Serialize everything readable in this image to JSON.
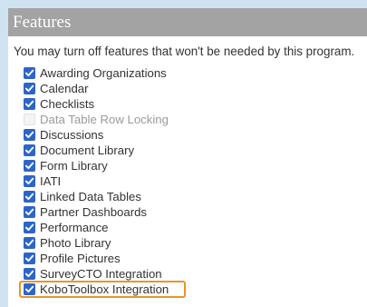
{
  "panel": {
    "title": "Features",
    "intro": "You may turn off features that won't be needed by this program."
  },
  "colors": {
    "checkbox_checked": "#2d64c8",
    "header_background": "#a3a3a3",
    "highlight": "#e6962e",
    "page_background": "#cfe4f0"
  },
  "features": [
    {
      "label": "Awarding Organizations",
      "checked": true
    },
    {
      "label": "Calendar",
      "checked": true
    },
    {
      "label": "Checklists",
      "checked": true
    },
    {
      "label": "Data Table Row Locking",
      "checked": false,
      "disabled": true
    },
    {
      "label": "Discussions",
      "checked": true
    },
    {
      "label": "Document Library",
      "checked": true
    },
    {
      "label": "Form Library",
      "checked": true
    },
    {
      "label": "IATI",
      "checked": true
    },
    {
      "label": "Linked Data Tables",
      "checked": true
    },
    {
      "label": "Partner Dashboards",
      "checked": true
    },
    {
      "label": "Performance",
      "checked": true
    },
    {
      "label": "Photo Library",
      "checked": true
    },
    {
      "label": "Profile Pictures",
      "checked": true
    },
    {
      "label": "SurveyCTO Integration",
      "checked": true
    },
    {
      "label": "KoboToolbox Integration",
      "checked": true,
      "highlighted": true
    }
  ]
}
